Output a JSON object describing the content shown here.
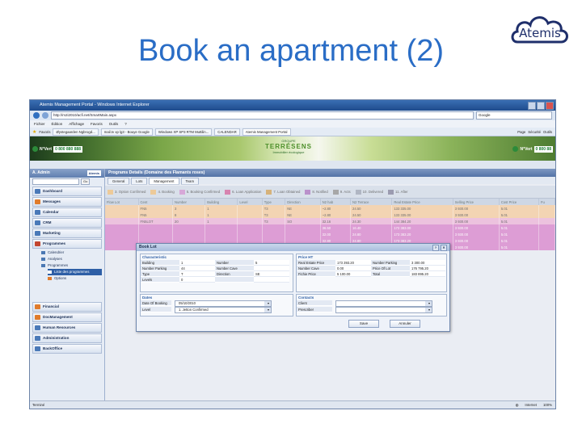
{
  "slide": {
    "title": "Book an apartment (2)"
  },
  "logo": {
    "text": "Atemis"
  },
  "browser": {
    "window_title": "Atemis Management Portal - Windows Internet Explorer",
    "address": "http://m2i2010/acfi.net/SmartMain.aspx",
    "search_placeholder": "Google",
    "menu": [
      "Fichier",
      "Édition",
      "Affichage",
      "Favoris",
      "Outils",
      "?"
    ],
    "favorites_label": "Favoris",
    "tabs": [
      {
        "label": "Øystegaarden Ngbrogd...",
        "active": false
      },
      {
        "label": "mail.tv xp lg3 - Bouye Google",
        "active": false
      },
      {
        "label": "Windows XP SP3 RTM Muttilin...",
        "active": false
      },
      {
        "label": "CALENDAR",
        "active": false
      },
      {
        "label": "Atemis Management Portal",
        "active": true
      }
    ],
    "tools": [
      "Page",
      "Sécurité",
      "Outils"
    ]
  },
  "banner": {
    "nvert_label": "N°Vert",
    "phone_left": "0 800 880 888",
    "phone_right": "0 800 88",
    "brand_top": "GROUPE",
    "brand_main": "TERRÉSENS",
    "brand_sub": "Immobilier écologique"
  },
  "sidebar": {
    "user": "A. Admin",
    "badge": "Atemis",
    "search_button": "Go",
    "items": [
      {
        "label": "Dashboard",
        "color": "#4a79b8"
      },
      {
        "label": "Messages",
        "color": "#e07b2b"
      },
      {
        "label": "Calendar",
        "color": "#4a79b8"
      },
      {
        "label": "CRM",
        "color": "#4a79b8"
      },
      {
        "label": "Marketing",
        "color": "#4a79b8"
      },
      {
        "label": "Programmes",
        "color": "#c2452f"
      }
    ],
    "sub_items": [
      "Calendrier",
      "Analyses",
      "Programmes"
    ],
    "sub_sub_items": [
      "Liste des programmes",
      "Options"
    ],
    "bottom_items": [
      "Financial",
      "DocManagement",
      "Human Resources",
      "Administration",
      "BackOffice"
    ]
  },
  "main": {
    "title": "Programs Details (Domaine des Flamants roses)",
    "tabs": [
      "General",
      "Lots",
      "Management",
      "Team"
    ],
    "statuses": [
      {
        "label": "3. Option Confirmed",
        "color": "#e8b268"
      },
      {
        "label": "4. Booking",
        "color": "#e8b268"
      },
      {
        "label": "5. Booking Confirmed",
        "color": "#c67fc8"
      },
      {
        "label": "6. Loan Application",
        "color": "#c6488a"
      },
      {
        "label": "7. Loan Obtained",
        "color": "#c58e3a"
      },
      {
        "label": "8. Notified",
        "color": "#9a5bb4"
      },
      {
        "label": "9. Acts",
        "color": "#7d7d7d"
      },
      {
        "label": "10. Delivered",
        "color": "#8a94a8"
      },
      {
        "label": "11. After",
        "color": "#6b6b8a"
      }
    ],
    "columns": [
      "Flow Lot",
      "Cent",
      "Number",
      "Building",
      "Level",
      "Type",
      "Direction",
      "N2 hab",
      "N2 Terrace",
      "Real Estate Price",
      "Selling Price",
      "Cost Price",
      "Fu"
    ],
    "rows": [
      {
        "style": "orange",
        "cells": [
          "",
          "FN5",
          "3",
          "1",
          "",
          "T3",
          "NE",
          "~2.80",
          "24.50",
          "133 335.00",
          "3 930.00",
          "5.01",
          ""
        ]
      },
      {
        "style": "orange",
        "cells": [
          "",
          "FN5",
          "8",
          "1",
          "",
          "T3",
          "NE",
          "~2.80",
          "24.50",
          "133 335.00",
          "3 930.00",
          "5.01",
          ""
        ]
      },
      {
        "style": "pink",
        "cells": [
          "",
          "FN5LOT",
          "20",
          "1",
          "",
          "T3",
          "SO",
          "32.16",
          "24.30",
          "144 384.20",
          "3 930.00",
          "5.01",
          ""
        ]
      },
      {
        "style": "magenta",
        "cells": [
          "",
          "",
          "",
          "",
          "",
          "",
          "",
          "36.50",
          "16.40",
          "172 383.00",
          "3 930.00",
          "5.01",
          ""
        ]
      },
      {
        "style": "magenta",
        "cells": [
          "",
          "",
          "",
          "",
          "",
          "",
          "",
          "32.00",
          "24.80",
          "173 383.20",
          "3 930.00",
          "5.01",
          ""
        ]
      },
      {
        "style": "magenta",
        "cells": [
          "",
          "",
          "",
          "",
          "",
          "",
          "",
          "32.80",
          "24.80",
          "173 383.20",
          "3 930.00",
          "5.01",
          ""
        ]
      },
      {
        "style": "magenta",
        "cells": [
          "",
          "",
          "",
          "",
          "",
          "",
          "",
          "36.90",
          "24.10",
          "173 343.20",
          "3 930.00",
          "5.01",
          ""
        ]
      }
    ]
  },
  "dialog": {
    "title": "Book Lot",
    "characteristic_header": "Characteristic",
    "characteristic": [
      [
        "Building",
        "1",
        "Number",
        "5"
      ],
      [
        "Number Parking",
        "44",
        "Number Cave",
        ""
      ],
      [
        "Type",
        "T",
        "Direction",
        "SE"
      ],
      [
        "Levels",
        "0",
        "",
        ""
      ]
    ],
    "price_header": "Price HT",
    "price": [
      [
        "Real Estate Price",
        "173 393.20",
        "Number Parking",
        "3 300.00"
      ],
      [
        "Number Cave",
        "0.00",
        "Price Of Lot",
        "176 795.20"
      ],
      [
        "Fichie Price",
        "5 100.00",
        "Total",
        "183 895.20"
      ]
    ],
    "dates_header": "Dates",
    "date_of_booking_label": "Date Of Booking",
    "date_of_booking": "05/10/2010",
    "level_label": "Level",
    "level_value": "1. Jetton Confirmed",
    "contacts_header": "Contacts",
    "client_label": "Client",
    "prescriber_label": "Prescriber",
    "save_label": "Save",
    "cancel_label": "Annuler"
  },
  "statusbar": {
    "left": "Terminé",
    "zone": "Internet",
    "zoom": "100%"
  }
}
